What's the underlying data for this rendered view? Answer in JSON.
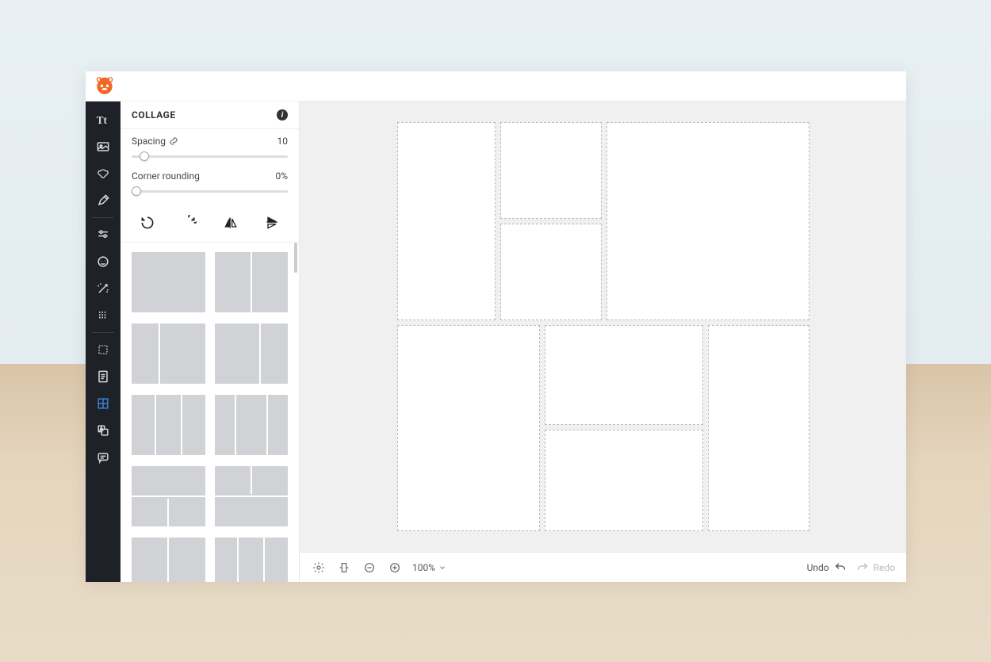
{
  "panel": {
    "title": "COLLAGE",
    "spacing_label": "Spacing",
    "spacing_value": "10",
    "corner_label": "Corner rounding",
    "corner_value": "0%"
  },
  "spacing_slider_pct": 5,
  "corner_slider_pct": 0,
  "toolstrip": [
    {
      "name": "text-tool",
      "icon": "text"
    },
    {
      "name": "image-tool",
      "icon": "image"
    },
    {
      "name": "shapes-tool",
      "icon": "butterfly"
    },
    {
      "name": "draw-tool",
      "icon": "pen"
    },
    {
      "name": "adjust-tool",
      "icon": "sliders"
    },
    {
      "name": "face-tool",
      "icon": "face"
    },
    {
      "name": "magic-tool",
      "icon": "wand"
    },
    {
      "name": "texture-tool",
      "icon": "grid"
    },
    {
      "name": "crop-tool",
      "icon": "crop"
    },
    {
      "name": "template-tool",
      "icon": "doc"
    },
    {
      "name": "collage-tool",
      "icon": "collage",
      "active": true
    },
    {
      "name": "translate-tool",
      "icon": "translate"
    },
    {
      "name": "chat-tool",
      "icon": "chat"
    }
  ],
  "bottombar": {
    "zoom": "100%",
    "undo": "Undo",
    "redo": "Redo"
  }
}
